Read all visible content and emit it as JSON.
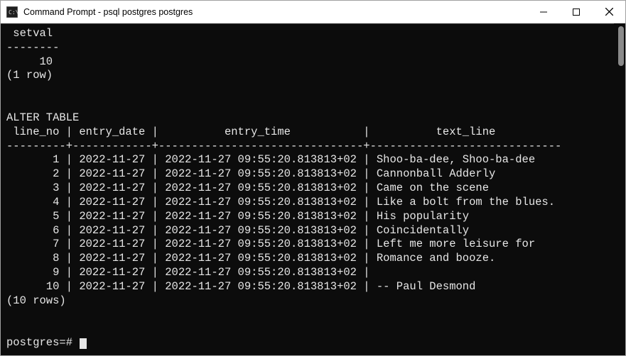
{
  "window": {
    "title": "Command Prompt - psql  postgres postgres"
  },
  "terminal": {
    "lines": [
      " setval",
      "--------",
      "     10",
      "(1 row)",
      "",
      "",
      "ALTER TABLE",
      " line_no | entry_date |          entry_time           |          text_line",
      "---------+------------+-------------------------------+-----------------------------",
      "       1 | 2022-11-27 | 2022-11-27 09:55:20.813813+02 | Shoo-ba-dee, Shoo-ba-dee",
      "       2 | 2022-11-27 | 2022-11-27 09:55:20.813813+02 | Cannonball Adderly",
      "       3 | 2022-11-27 | 2022-11-27 09:55:20.813813+02 | Came on the scene",
      "       4 | 2022-11-27 | 2022-11-27 09:55:20.813813+02 | Like a bolt from the blues.",
      "       5 | 2022-11-27 | 2022-11-27 09:55:20.813813+02 | His popularity",
      "       6 | 2022-11-27 | 2022-11-27 09:55:20.813813+02 | Coincidentally",
      "       7 | 2022-11-27 | 2022-11-27 09:55:20.813813+02 | Left me more leisure for",
      "       8 | 2022-11-27 | 2022-11-27 09:55:20.813813+02 | Romance and booze.",
      "       9 | 2022-11-27 | 2022-11-27 09:55:20.813813+02 |",
      "      10 | 2022-11-27 | 2022-11-27 09:55:20.813813+02 | -- Paul Desmond",
      "(10 rows)",
      "",
      ""
    ],
    "prompt": "postgres=#"
  }
}
